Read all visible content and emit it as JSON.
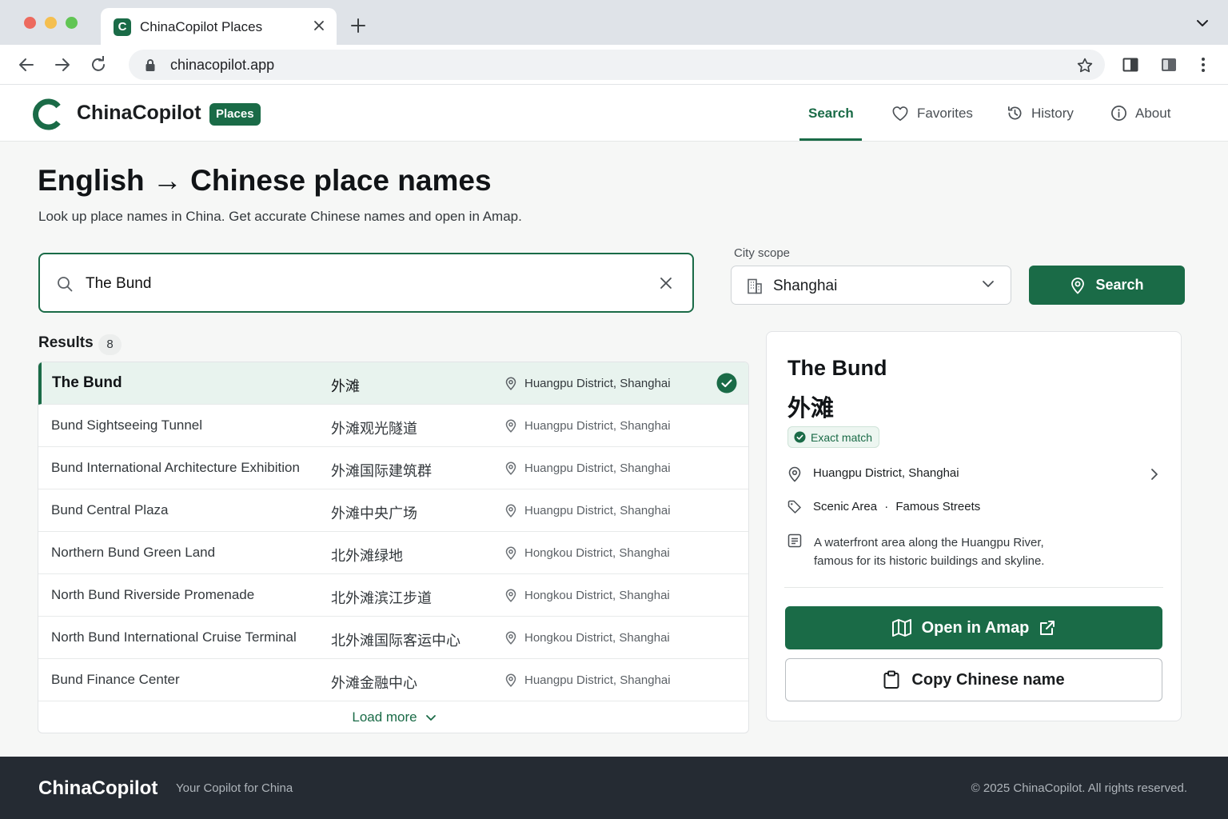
{
  "browser": {
    "tab_title": "ChinaCopilot Places",
    "favicon_letter": "C",
    "url": "chinacopilot.app"
  },
  "header": {
    "brand": "ChinaCopilot",
    "badge": "Places",
    "nav": {
      "search": "Search",
      "favorites": "Favorites",
      "history": "History",
      "about": "About"
    }
  },
  "main": {
    "title": "English → Chinese place names",
    "subtitle": "Look up place names in China. Get accurate Chinese names and open in Amap.",
    "search": {
      "value": "The Bund",
      "placeholder": ""
    },
    "city_scope": {
      "label": "City scope",
      "value": "Shanghai"
    },
    "search_button": "Search"
  },
  "results": {
    "label": "Results",
    "count": "8",
    "items": [
      {
        "en": "The Bund",
        "zh": "外滩",
        "location": "Huangpu District, Shanghai"
      },
      {
        "en": "Bund Sightseeing Tunnel",
        "zh": "外滩观光隧道",
        "location": "Huangpu District, Shanghai"
      },
      {
        "en": "Bund International Architecture Exhibition",
        "zh": "外滩国际建筑群",
        "location": "Huangpu District, Shanghai"
      },
      {
        "en": "Bund Central Plaza",
        "zh": "外滩中央广场",
        "location": "Huangpu District, Shanghai"
      },
      {
        "en": "Northern Bund Green Land",
        "zh": "北外滩绿地",
        "location": "Hongkou District, Shanghai"
      },
      {
        "en": "North Bund Riverside Promenade",
        "zh": "北外滩滨江步道",
        "location": "Hongkou District, Shanghai"
      },
      {
        "en": "North Bund International Cruise Terminal",
        "zh": "北外滩国际客运中心",
        "location": "Hongkou District, Shanghai"
      },
      {
        "en": "Bund Finance Center",
        "zh": "外滩金融中心",
        "location": "Huangpu District, Shanghai"
      }
    ],
    "load_more": "Load more"
  },
  "detail": {
    "title": "The Bund",
    "zh": "外滩",
    "match_badge": "Exact match",
    "location": "Huangpu District, Shanghai",
    "category": "Scenic Area",
    "category_sep": "·",
    "subcategory": "Famous Streets",
    "description": "A waterfront area along the Huangpu River, famous for its historic buildings and skyline.",
    "open_button": "Open in Amap",
    "copy_button": "Copy Chinese name"
  },
  "footer": {
    "brand": "ChinaCopilot",
    "tagline": "Your Copilot for China",
    "copyright": "© 2025 ChinaCopilot. All rights reserved."
  },
  "colors": {
    "accent": "#1a6b47",
    "selected_row": "#e8f3ee",
    "footer_bg": "#252b33"
  }
}
